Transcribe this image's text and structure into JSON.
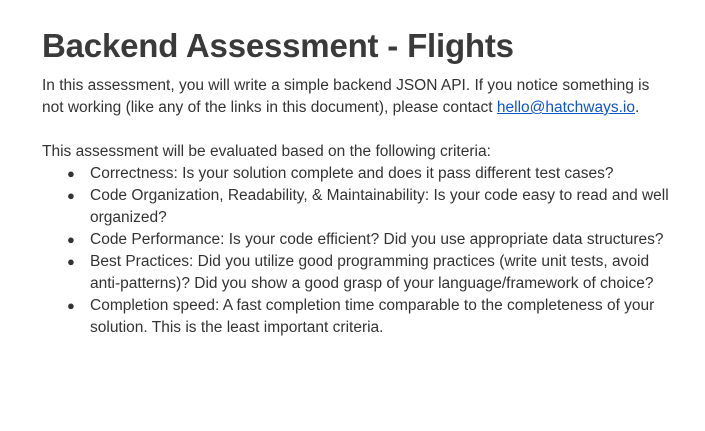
{
  "document": {
    "title": "Backend Assessment - Flights",
    "intro_text": "In this assessment, you will write a simple backend JSON API. If you notice something is not working (like any of the links in this document), please contact ",
    "contact_email": "hello@hatchways.io",
    "intro_end": ".",
    "criteria_intro": "This assessment will be evaluated based on the following criteria:",
    "bullet_icon": "bullet-dot",
    "criteria": [
      "Correctness: Is your solution complete and does it pass different test cases?",
      "Code Organization, Readability, & Maintainability: Is your code easy to read and well organized?",
      "Code Performance: Is your code efficient? Did you use appropriate data structures?",
      "Best Practices: Did you utilize good programming practices (write unit tests, avoid anti-patterns)? Did you show a good grasp of your language/framework of choice?",
      "Completion speed: A fast completion time comparable to the completeness of your solution. This is the least important criteria."
    ]
  },
  "colors": {
    "text": "#333333",
    "heading": "#3a3a3a",
    "link": "#1155cc",
    "background": "#ffffff"
  }
}
